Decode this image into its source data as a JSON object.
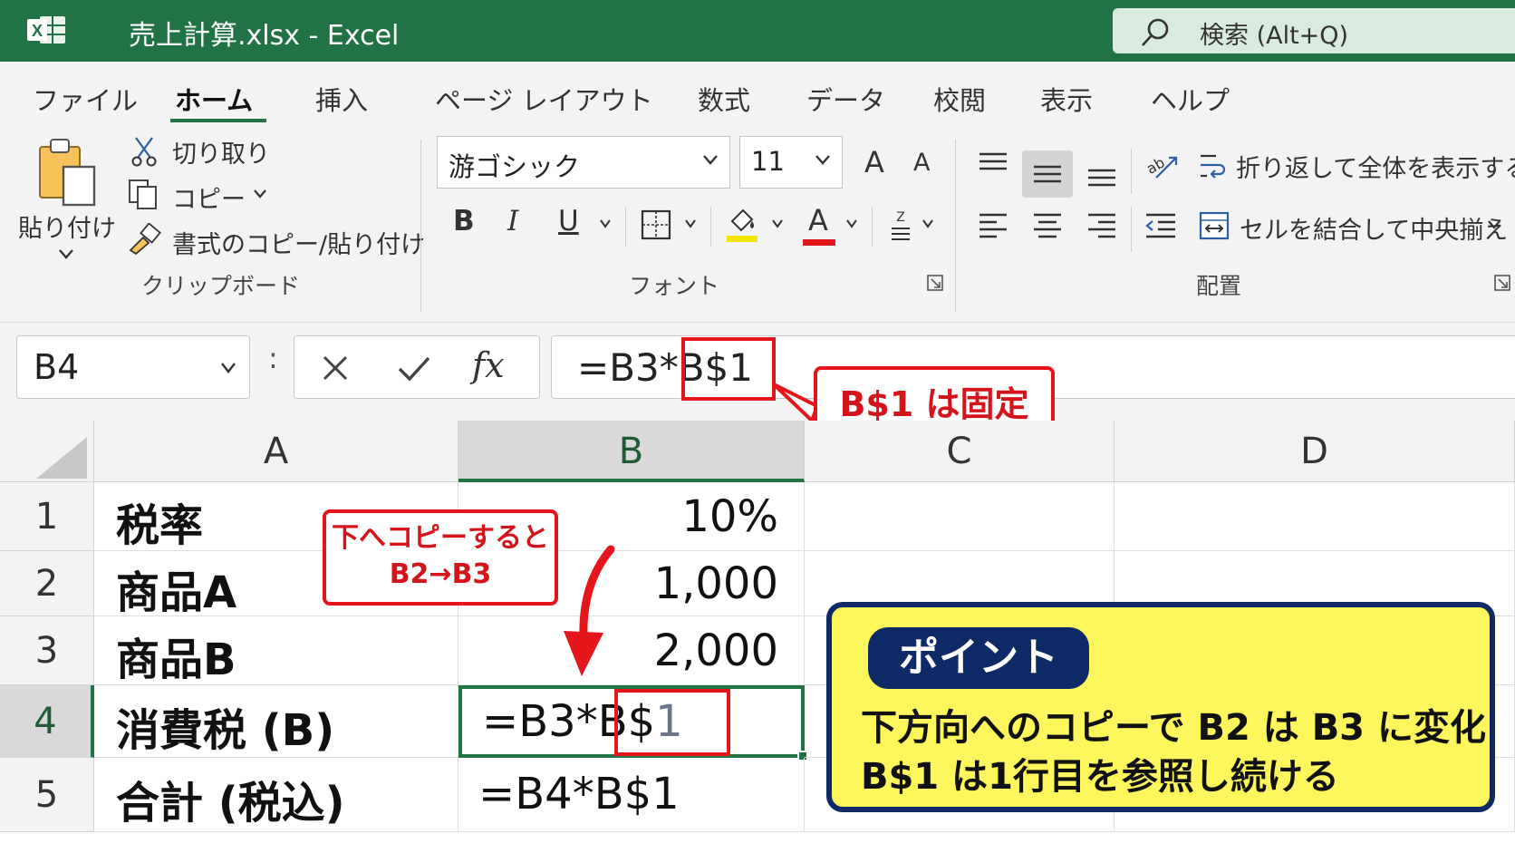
{
  "titlebar": {
    "app_icon_letter": "X",
    "title": "売上計算.xlsx  -  Excel",
    "search_placeholder": "検索 (Alt+Q)"
  },
  "tabs": [
    "ファイル",
    "ホーム",
    "挿入",
    "ページ レイアウト",
    "数式",
    "データ",
    "校閲",
    "表示",
    "ヘルプ"
  ],
  "active_tab": "ホーム",
  "ribbon": {
    "clipboard": {
      "paste_label": "貼り付け",
      "cut_label": "切り取り",
      "copy_label": "コピー",
      "format_painter_label": "書式のコピー/貼り付け",
      "group_label": "クリップボード"
    },
    "font": {
      "font_name": "游ゴシック",
      "font_size": "11",
      "grow_label": "A",
      "shrink_label": "A",
      "bold_label": "B",
      "italic_label": "I",
      "underline_label": "U",
      "font_color_letter": "A",
      "group_label": "フォント",
      "highlight_color": "#f4e500",
      "font_color": "#e4161c"
    },
    "alignment": {
      "wrap_text_label": "折り返して全体を表示する",
      "merge_center_label": "セルを結合して中央揃え",
      "group_label": "配置"
    }
  },
  "formula_bar": {
    "name_box": "B4",
    "separator": ":",
    "fx_label": "fx",
    "formula_prefix": "=B3*",
    "formula_highlight": "B$1",
    "callout": "B$1 は固定"
  },
  "grid": {
    "column_headers": [
      "A",
      "B",
      "C",
      "D"
    ],
    "selected_column": "B",
    "row_headers": [
      "1",
      "2",
      "3",
      "4",
      "5"
    ],
    "selected_row": "4",
    "rows": [
      {
        "a": "税率",
        "b": "10%"
      },
      {
        "a": "商品A",
        "b": "1,000"
      },
      {
        "a": "商品B",
        "b": "2,000"
      },
      {
        "a": "消費税 (B)",
        "b_prefix": "=B3*",
        "b_highlight_main": "B$",
        "b_highlight_digit": "1"
      },
      {
        "a": "合計 (税込)",
        "b": "=B4*B$1"
      }
    ],
    "copy_callout_line1": "下へコピーすると",
    "copy_callout_line2": "B2→B3"
  },
  "point": {
    "badge": "ポイント",
    "line1": "下方向へのコピーで B2 は B3 に変化",
    "line2": "B$1 は1行目を参照し続ける"
  },
  "colors": {
    "excel_green": "#217346",
    "annotation_red": "#e4161c",
    "point_bg": "#fdf65c",
    "point_navy": "#0e2a66",
    "digit_gray": "#6b7488"
  }
}
